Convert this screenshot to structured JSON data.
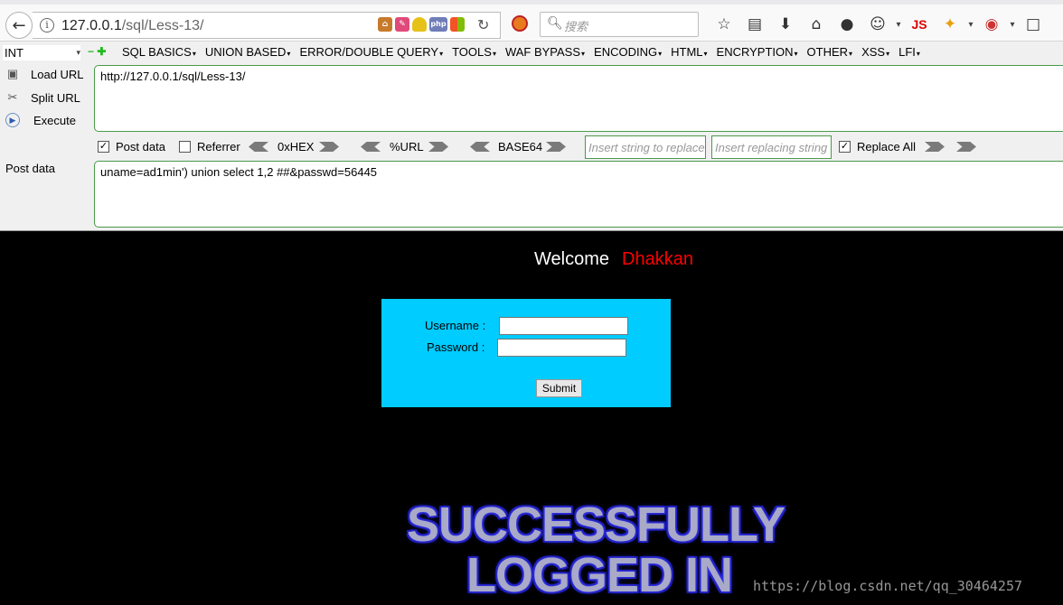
{
  "browser": {
    "url_host": "127.0.0.1",
    "url_path": "/sql/Less-13/",
    "search_placeholder": "搜索",
    "js_label": "JS"
  },
  "hackbar": {
    "select_value": "INT",
    "menu": [
      "SQL BASICS",
      "UNION BASED",
      "ERROR/DOUBLE QUERY",
      "TOOLS",
      "WAF BYPASS",
      "ENCODING",
      "HTML",
      "ENCRYPTION",
      "OTHER",
      "XSS",
      "LFI"
    ],
    "load_url": "Load URL",
    "split_url": "Split URL",
    "execute": "Execute",
    "url_value": "http://127.0.0.1/sql/Less-13/",
    "post_data_checkbox": "Post data",
    "referrer_checkbox": "Referrer",
    "hex_label": "0xHEX",
    "url_enc_label": "%URL",
    "base64_label": "BASE64",
    "replace_placeholder": "Insert string to replace",
    "replacing_placeholder": "Insert replacing string",
    "replace_all": "Replace All",
    "post_data_label": "Post data",
    "post_value": "uname=ad1min') union select 1,2 ##&passwd=56445"
  },
  "page": {
    "welcome": "Welcome",
    "welcome_name": "Dhakkan",
    "username_label": "Username :",
    "password_label": "Password :",
    "submit_label": "Submit",
    "success_line1": "SUCCESSFULLY",
    "success_line2": "LOGGED IN",
    "watermark": "https://blog.csdn.net/qq_30464257"
  },
  "colors": {
    "login_box": "#00ccff",
    "welcome_name": "#ff0000",
    "background": "#000000"
  }
}
